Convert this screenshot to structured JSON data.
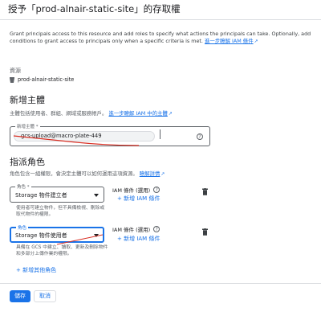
{
  "header": {
    "title": "授予「prod-alnair-static-site」的存取權"
  },
  "intro": {
    "text": "Grant principals access to this resource and add roles to specify what actions the principals can take. Optionally, add conditions to grant access to principals only when a specific criteria is met.",
    "link": "進一步瞭解 IAM 條件"
  },
  "resource": {
    "label": "資源",
    "name": "prod-alnair-static-site",
    "icon": "bucket-icon"
  },
  "add_principals": {
    "title": "新增主體",
    "desc": "主體包括使用者、群組、網域或服務帳戶。",
    "link": "進一步瞭解 IAM 中的主體",
    "field_label": "新增主體 *",
    "chip_text": "gcs-upload@macro-plate-449",
    "help_icon": "help-circle-icon",
    "annotation_color": "#d93025"
  },
  "assign_roles": {
    "title": "指派角色",
    "desc": "角色包含一組權限，會決定主體可以如何運用這項資源。",
    "link": "瞭解詳情",
    "roles": [
      {
        "field_label": "角色 *",
        "value": "Storage 物件建立者",
        "desc": "使用者可建立物件，但不具備檢視、刪除或取代物件的權限。",
        "condition_label": "IAM 條件 (選用)",
        "add_condition": "新增 IAM 條件"
      },
      {
        "field_label": "角色",
        "value": "Storage 物件使用者",
        "desc": "具備在 GCS 中建立、讀取、更新及刪除物件和多部分上傳作業的權限。",
        "condition_label": "IAM 條件 (選用)",
        "add_condition": "新增 IAM 條件"
      }
    ],
    "add_role": "新增其他角色"
  },
  "footer": {
    "save": "儲存",
    "cancel": "取消"
  }
}
